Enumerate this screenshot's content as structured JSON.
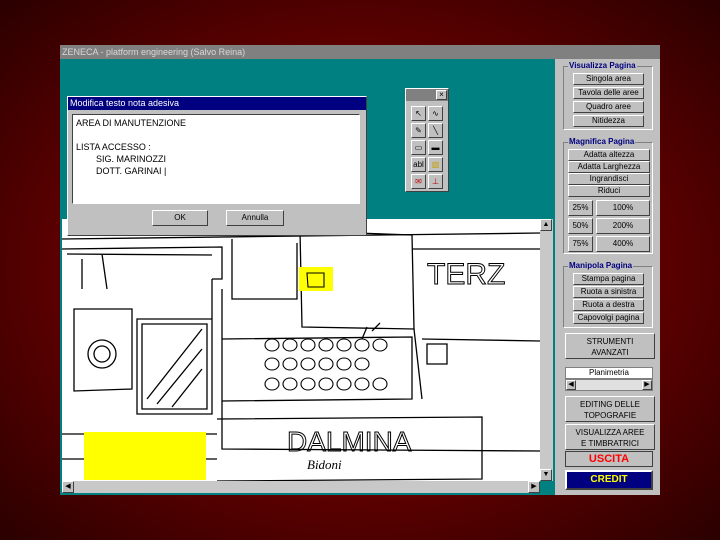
{
  "app": {
    "title": "ZENECA - platform engineering (Salvo Reina)"
  },
  "dialog": {
    "title": "Modifica testo nota adesiva",
    "text": "AREA DI MANUTENZIONE\n\nLISTA ACCESSO :\n        SIG. MARINOZZI\n        DOTT. GARINAI |",
    "ok_label": "OK",
    "cancel_label": "Annulla"
  },
  "toolbox": {
    "close_label": "×",
    "text_tool_label": "abl"
  },
  "drawing": {
    "labels": [
      "TERZ",
      "DALMINA",
      "Bidoni"
    ],
    "highlight_color": "#ffff00"
  },
  "panel": {
    "visualizza": {
      "title": "Visualizza Pagina",
      "items": [
        "Singola area",
        "Tavola delle aree",
        "Quadro aree",
        "Nitidezza"
      ]
    },
    "magnifica": {
      "title": "Magnifica Pagina",
      "items": [
        "Adatta altezza",
        "Adatta Larghezza",
        "Ingrandisci",
        "Riduci"
      ],
      "zoom": [
        "25%",
        "100%",
        "50%",
        "200%",
        "75%",
        "400%"
      ]
    },
    "manipola": {
      "title": "Manipola Pagina",
      "items": [
        "Stampa pagina",
        "Ruota a sinistra",
        "Ruota a destra",
        "Capovolgi pagina"
      ]
    },
    "strumenti_label": "STRUMENTI\nAVANZATI",
    "planimetria_label": "Planimetria",
    "editing_label": "EDITING DELLE\nTOPOGRAFIE",
    "visualizza_aree_label": "VISUALIZZA AREE\nE TIMBRATRICI",
    "uscita_label": "USCITA",
    "credit_label": "CREDIT"
  },
  "colors": {
    "workspace": "#008080",
    "dialog_title": "#000080",
    "uscita": "#ff0000",
    "credit_bg": "#000080",
    "credit_text": "#ffff00"
  }
}
